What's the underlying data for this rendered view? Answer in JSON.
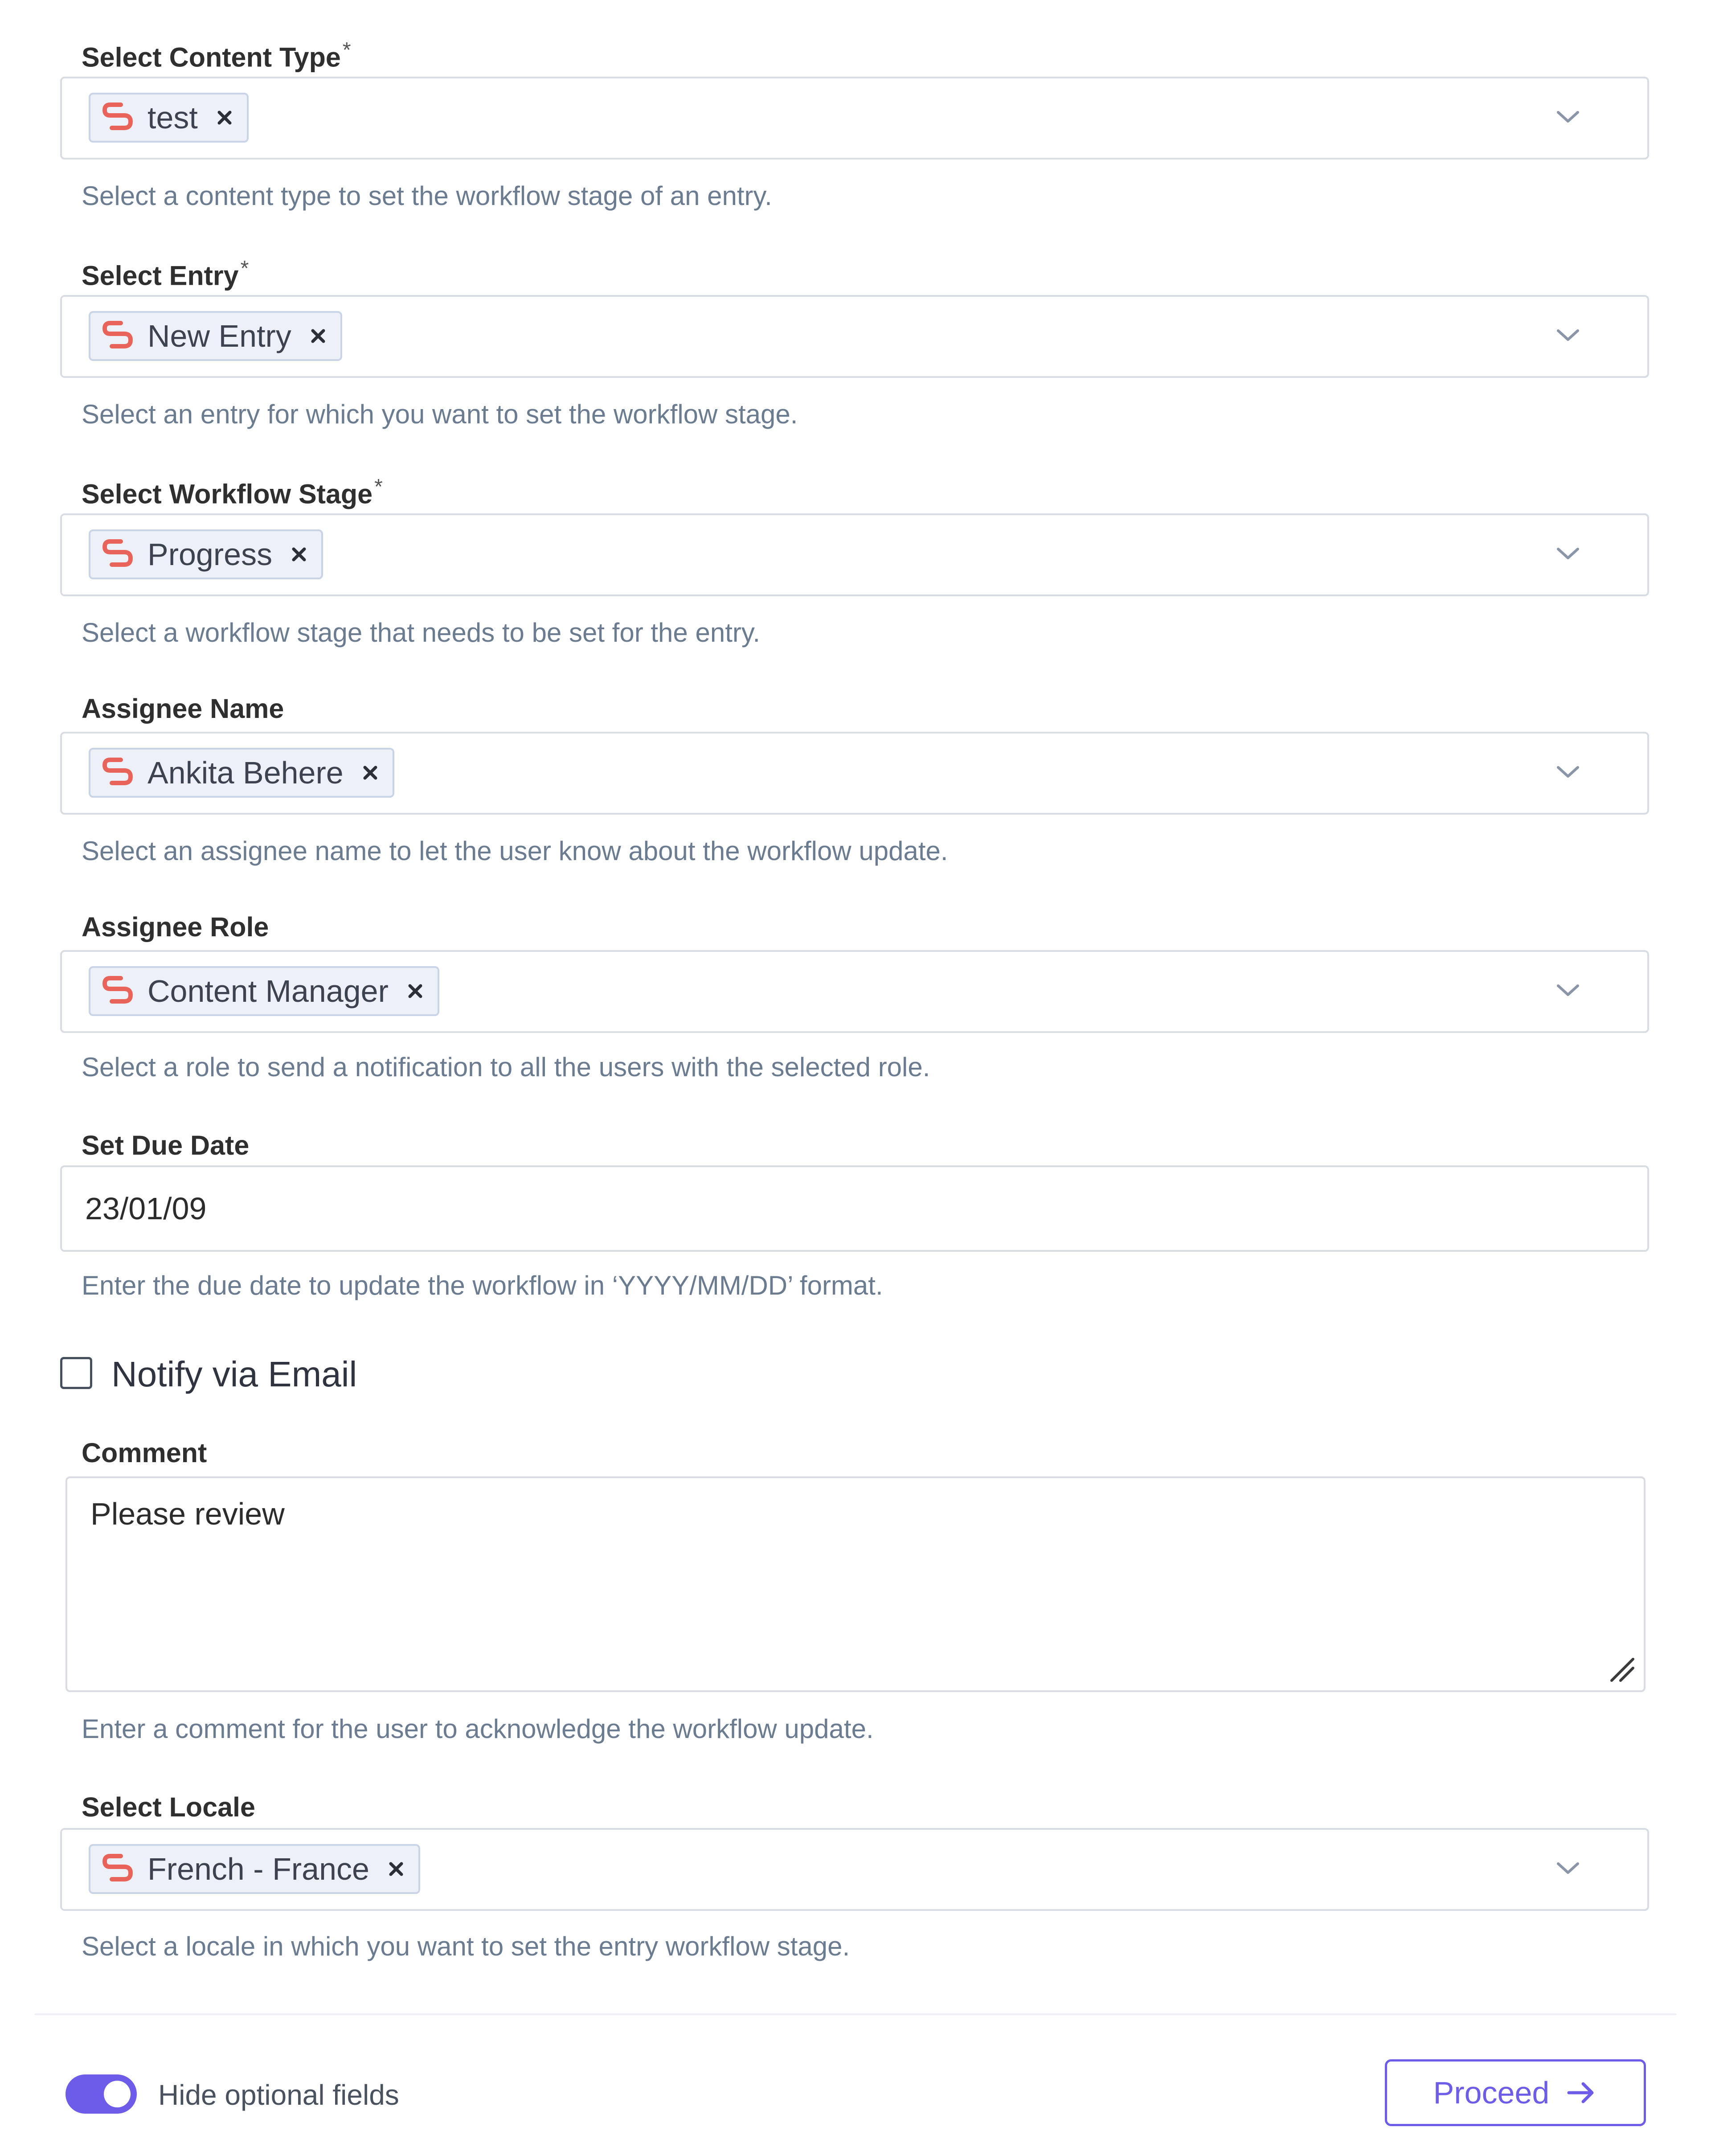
{
  "fields": {
    "content_type": {
      "label": "Select Content Type",
      "required_mark": "*",
      "value": "test",
      "help": "Select a content type to set the workflow stage of an entry."
    },
    "entry": {
      "label": "Select Entry",
      "required_mark": "*",
      "value": "New Entry",
      "help": "Select an entry for which you want to set the workflow stage."
    },
    "workflow_stage": {
      "label": "Select Workflow Stage",
      "required_mark": "*",
      "value": "Progress",
      "help": "Select a workflow stage that needs to be set for the entry."
    },
    "assignee_name": {
      "label": "Assignee Name",
      "value": "Ankita Behere",
      "help": "Select an assignee name to let the user know about the workflow update."
    },
    "assignee_role": {
      "label": "Assignee Role",
      "value": "Content Manager",
      "help": "Select a role to send a notification to all the users with the selected role."
    },
    "due_date": {
      "label": "Set Due Date",
      "value": "23/01/09",
      "help": "Enter the due date to update the workflow in ‘YYYY/MM/DD’ format."
    },
    "notify_email": {
      "label": "Notify via Email",
      "checked": false
    },
    "comment": {
      "label": "Comment",
      "value": "Please review",
      "help": "Enter a comment for the user to acknowledge the workflow update."
    },
    "locale": {
      "label": "Select Locale",
      "value": "French - France",
      "help": "Select a locale in which you want to set the entry workflow stage."
    }
  },
  "footer": {
    "toggle_label": "Hide optional fields",
    "toggle_on": true,
    "proceed_label": "Proceed"
  },
  "icons": {
    "chip_icon": "connector-logo-icon",
    "remove": "close-icon",
    "dropdown": "chevron-down-icon",
    "resize": "resize-handle-icon",
    "proceed": "arrow-right-icon"
  },
  "colors": {
    "accent": "#6c5ce7",
    "chip_icon": "#e8645a",
    "chip_bg": "#edf1f7",
    "help_text": "#6b7b90"
  }
}
